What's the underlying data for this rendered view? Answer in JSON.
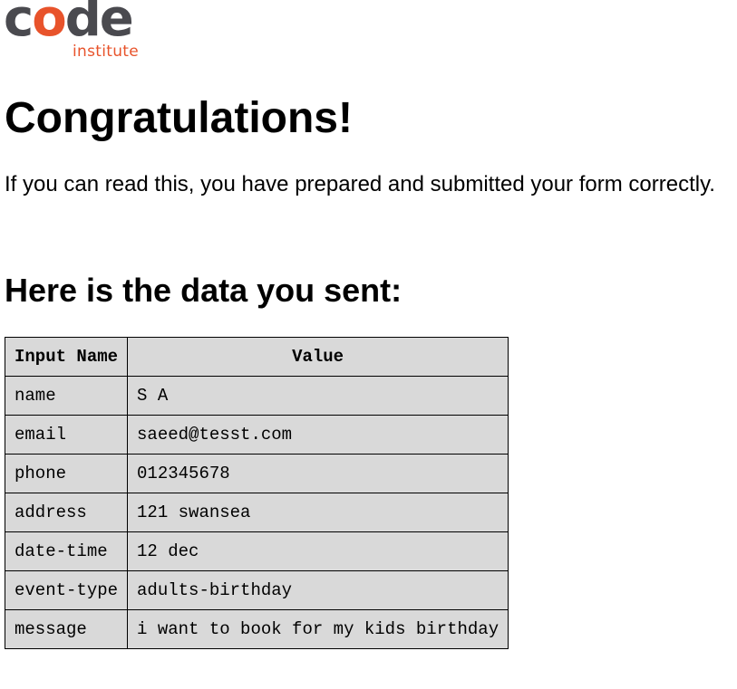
{
  "logo": {
    "word_part1": "c",
    "word_part2": "o",
    "word_part3": "de",
    "subtitle": "institute",
    "colors": {
      "dark": "#4a4a4f",
      "orange": "#e8532b"
    }
  },
  "heading": "Congratulations!",
  "intro": "If you can read this, you have prepared and submitted your form correctly.",
  "subheading": "Here is the data you sent:",
  "table": {
    "headers": [
      "Input Name",
      "Value"
    ],
    "rows": [
      {
        "name": "name",
        "value": "S A"
      },
      {
        "name": "email",
        "value": "saeed@tesst.com"
      },
      {
        "name": "phone",
        "value": "012345678"
      },
      {
        "name": "address",
        "value": "121 swansea"
      },
      {
        "name": "date-time",
        "value": "12 dec"
      },
      {
        "name": "event-type",
        "value": "adults-birthday"
      },
      {
        "name": "message",
        "value": "i want to book for my kids birthday"
      }
    ]
  }
}
